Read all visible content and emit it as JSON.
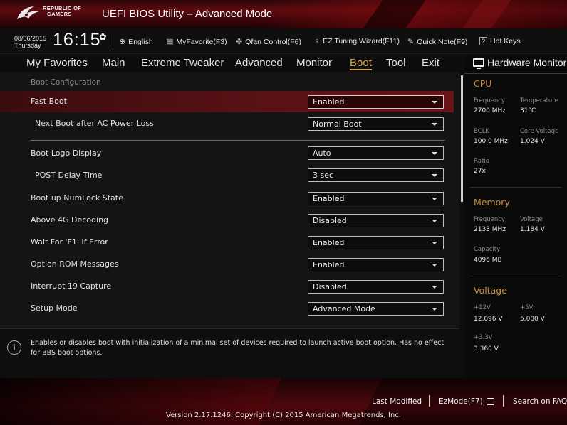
{
  "app": {
    "brand_line1": "REPUBLIC OF",
    "brand_line2": "GAMERS",
    "title": "UEFI BIOS Utility – Advanced Mode"
  },
  "toolbar": {
    "date": "08/06/2015",
    "day": "Thursday",
    "time": "16:15",
    "language": "English",
    "favorite": "MyFavorite(F3)",
    "qfan": "Qfan Control(F6)",
    "ez_tuning": "EZ Tuning Wizard(F11)",
    "quick_note": "Quick Note(F9)",
    "hot_keys": "Hot Keys",
    "hot_keys_key": "?"
  },
  "menu": {
    "items": [
      "My Favorites",
      "Main",
      "Extreme Tweaker",
      "Advanced",
      "Monitor",
      "Boot",
      "Tool",
      "Exit"
    ],
    "active": "Boot"
  },
  "boot": {
    "section_title": "Boot Configuration",
    "settings": [
      {
        "label": "Fast Boot",
        "value": "Enabled"
      },
      {
        "label": "Next Boot after AC Power Loss",
        "value": "Normal Boot"
      },
      {
        "label": "Boot Logo Display",
        "value": "Auto"
      },
      {
        "label": "POST Delay Time",
        "value": "3 sec"
      },
      {
        "label": "Boot up NumLock State",
        "value": "Enabled"
      },
      {
        "label": "Above 4G Decoding",
        "value": "Disabled"
      },
      {
        "label": "Wait For 'F1' If Error",
        "value": "Enabled"
      },
      {
        "label": "Option ROM Messages",
        "value": "Enabled"
      },
      {
        "label": "Interrupt 19 Capture",
        "value": "Disabled"
      },
      {
        "label": "Setup Mode",
        "value": "Advanced Mode"
      }
    ]
  },
  "help": {
    "text": "Enables or disables boot with initialization of a minimal set of devices required to launch active boot option. Has no effect for BBS boot options."
  },
  "hardware_monitor": {
    "title": "Hardware Monitor",
    "cpu": {
      "title": "CPU",
      "frequency_label": "Frequency",
      "frequency": "2700 MHz",
      "temperature_label": "Temperature",
      "temperature": "31°C",
      "bclk_label": "BCLK",
      "bclk": "100.0 MHz",
      "core_voltage_label": "Core Voltage",
      "core_voltage": "1.024 V",
      "ratio_label": "Ratio",
      "ratio": "27x"
    },
    "memory": {
      "title": "Memory",
      "frequency_label": "Frequency",
      "frequency": "2133 MHz",
      "voltage_label": "Voltage",
      "voltage": "1.184 V",
      "capacity_label": "Capacity",
      "capacity": "4096 MB"
    },
    "voltage": {
      "title": "Voltage",
      "v12_label": "+12V",
      "v12": "12.096 V",
      "v5_label": "+5V",
      "v5": "5.000 V",
      "v33_label": "+3.3V",
      "v33": "3.360 V"
    }
  },
  "footer": {
    "last_modified": "Last Modified",
    "ez_mode": "EzMode(F7)|",
    "search": "Search on FAQ",
    "version": "Version 2.17.1246. Copyright (C) 2015 American Megatrends, Inc."
  },
  "colors": {
    "accent": "#c98d3a",
    "highlight_row": "#5a1216",
    "title_bar": "#5e0b0f"
  }
}
